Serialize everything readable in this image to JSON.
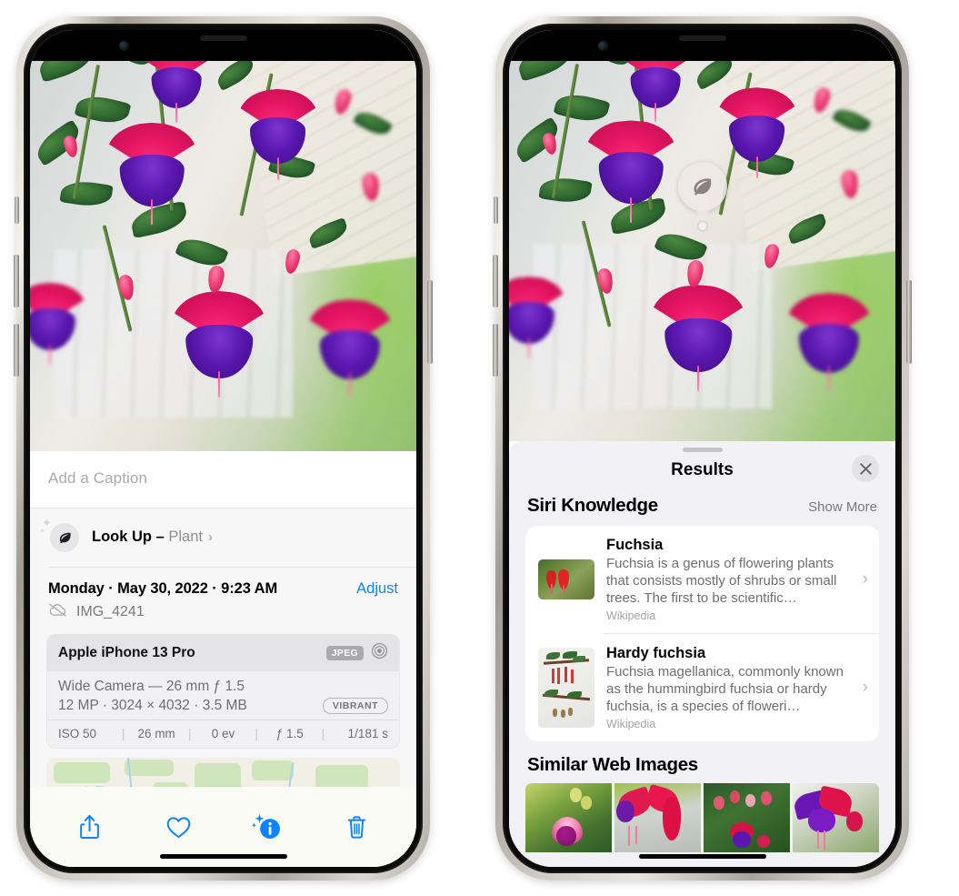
{
  "left_phone": {
    "caption_placeholder": "Add a Caption",
    "lookup": {
      "icon": "leaf-icon",
      "label": "Look Up",
      "dash": " – ",
      "subject": "Plant",
      "chevron": "›"
    },
    "date_line": "Monday · May 30, 2022 · 9:23 AM",
    "adjust_label": "Adjust",
    "file_name": "IMG_4241",
    "icloud_icon": "cloud-slash-icon",
    "camera": {
      "model": "Apple iPhone 13 Pro",
      "format_badge": "JPEG",
      "raw_icon": "aperture-icon",
      "lens_line": "Wide Camera — 26 mm ƒ 1.5",
      "specs_line": "12 MP · 3024 × 4032 · 3.5 MB",
      "style_badge": "VIBRANT",
      "exif": [
        "ISO 50",
        "26 mm",
        "0 ev",
        "ƒ 1.5",
        "1/181 s"
      ]
    },
    "toolbar": [
      {
        "name": "share-icon",
        "label": "Share"
      },
      {
        "name": "heart-icon",
        "label": "Favorite"
      },
      {
        "name": "info-icon",
        "label": "Info"
      },
      {
        "name": "trash-icon",
        "label": "Delete"
      }
    ]
  },
  "right_phone": {
    "leaf_badge": "leaf-icon",
    "results_title": "Results",
    "close_icon": "close-icon",
    "siri_knowledge": {
      "title": "Siri Knowledge",
      "show_more": "Show More",
      "items": [
        {
          "name": "Fuchsia",
          "description": "Fuchsia is a genus of flowering plants that consists mostly of shrubs or small trees. The first to be scientific…",
          "source": "Wikipedia",
          "chevron": "›"
        },
        {
          "name": "Hardy fuchsia",
          "description": "Fuchsia magellanica, commonly known as the hummingbird fuchsia or hardy fuchsia, is a species of floweri…",
          "source": "Wikipedia",
          "chevron": "›"
        }
      ]
    },
    "similar_web_images": {
      "title": "Similar Web Images",
      "count": 4
    }
  },
  "colors": {
    "accent_blue": "#0a84ff",
    "sheet_bg": "#f7f7f7",
    "results_bg": "#f2f1f5",
    "card_bg": "#ffffff",
    "secondary_text": "#6e6e73",
    "flower_pink": "#e51463",
    "flower_purple": "#5a17b0",
    "leaf_green": "#2f6830"
  }
}
